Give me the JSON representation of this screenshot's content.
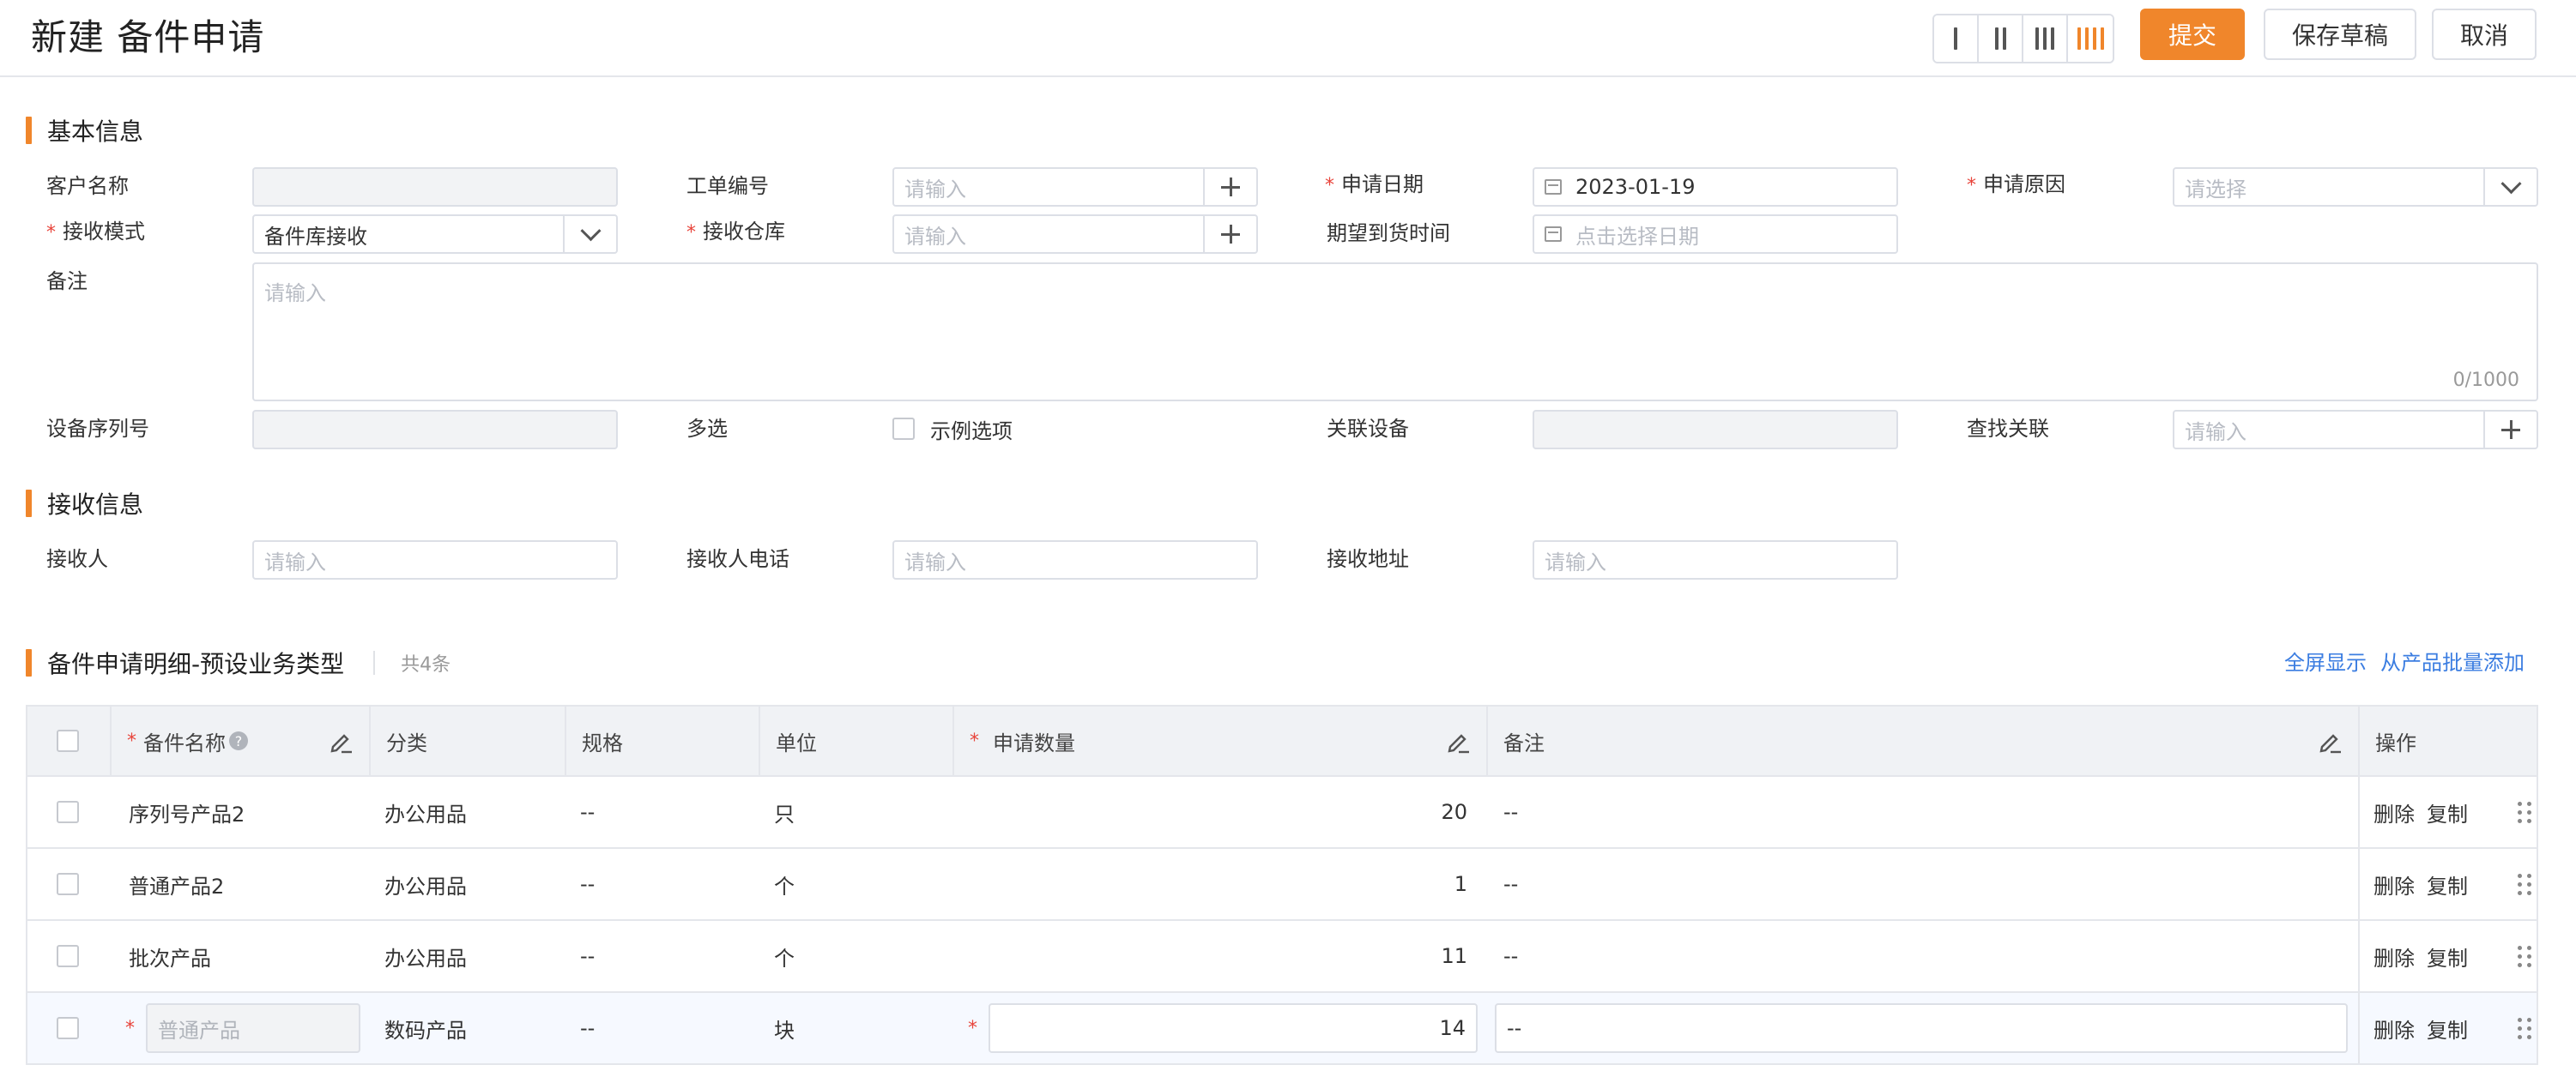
{
  "header": {
    "title": "新建 备件申请",
    "submit": "提交",
    "save_draft": "保存草稿",
    "cancel": "取消",
    "accent_color": "#f0862b"
  },
  "basic": {
    "section_title": "基本信息",
    "customer_name": {
      "label": "客户名称",
      "value": ""
    },
    "work_order_no": {
      "label": "工单编号",
      "placeholder": "请输入"
    },
    "apply_date": {
      "label": "申请日期",
      "value": "2023-01-19"
    },
    "apply_reason": {
      "label": "申请原因",
      "placeholder": "请选择"
    },
    "receive_mode": {
      "label": "接收模式",
      "value": "备件库接收"
    },
    "receive_warehouse": {
      "label": "接收仓库",
      "placeholder": "请输入"
    },
    "expected_time": {
      "label": "期望到货时间",
      "placeholder": "点击选择日期"
    },
    "remark": {
      "label": "备注",
      "placeholder": "请输入",
      "counter": "0/1000"
    },
    "device_serial": {
      "label": "设备序列号",
      "value": ""
    },
    "multi_select": {
      "label": "多选",
      "option": "示例选项"
    },
    "related_device": {
      "label": "关联设备",
      "value": ""
    },
    "find_related": {
      "label": "查找关联",
      "placeholder": "请输入"
    }
  },
  "receive": {
    "section_title": "接收信息",
    "receiver": {
      "label": "接收人",
      "placeholder": "请输入"
    },
    "receiver_phone": {
      "label": "接收人电话",
      "placeholder": "请输入"
    },
    "receiver_address": {
      "label": "接收地址",
      "placeholder": "请输入"
    }
  },
  "detail": {
    "section_title": "备件申请明细-预设业务类型",
    "count": "共4条",
    "fullscreen": "全屏显示",
    "batch_add": "从产品批量添加",
    "columns": {
      "name": "备件名称",
      "category": "分类",
      "spec": "规格",
      "unit": "单位",
      "quantity": "申请数量",
      "remark": "备注",
      "actions": "操作"
    },
    "help": "?",
    "delete": "删除",
    "copy": "复制",
    "rows": [
      {
        "name": "序列号产品2",
        "category": "办公用品",
        "spec": "--",
        "unit": "只",
        "quantity": "20",
        "remark": "--"
      },
      {
        "name": "普通产品2",
        "category": "办公用品",
        "spec": "--",
        "unit": "个",
        "quantity": "1",
        "remark": "--"
      },
      {
        "name": "批次产品",
        "category": "办公用品",
        "spec": "--",
        "unit": "个",
        "quantity": "11",
        "remark": "--"
      },
      {
        "name": "普通产品",
        "category": "数码产品",
        "spec": "--",
        "unit": "块",
        "quantity": "14",
        "remark": "--"
      }
    ]
  },
  "required_mark": "*"
}
